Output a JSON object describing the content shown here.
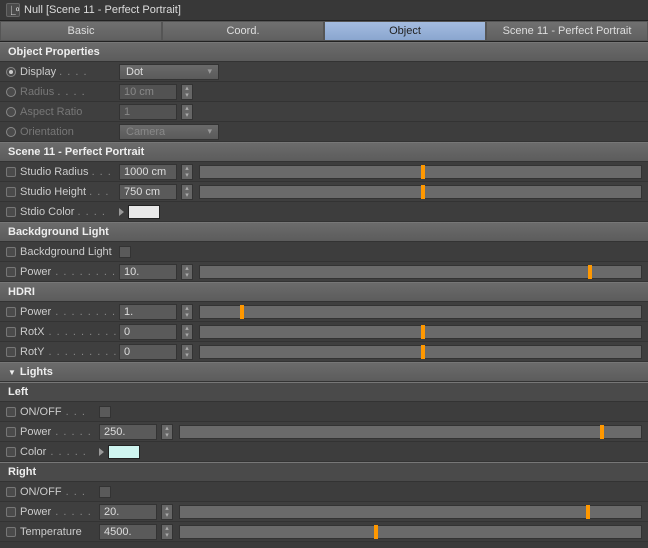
{
  "title": "Null [Scene 11 - Perfect Portrait]",
  "tabs": [
    "Basic",
    "Coord.",
    "Object",
    "Scene 11 - Perfect Portrait"
  ],
  "active_tab": 2,
  "sections": {
    "objprops": {
      "header": "Object Properties",
      "display": {
        "label": "Display",
        "value": "Dot"
      },
      "radius": {
        "label": "Radius",
        "value": "10 cm"
      },
      "aspect": {
        "label": "Aspect Ratio",
        "value": "1"
      },
      "orientation": {
        "label": "Orientation",
        "value": "Camera"
      }
    },
    "scene": {
      "header": "Scene 11 - Perfect Portrait",
      "studio_radius": {
        "label": "Studio Radius",
        "value": "1000 cm",
        "pos": 50
      },
      "studio_height": {
        "label": "Studio Height",
        "value": "750 cm",
        "pos": 50
      },
      "stdio_color": {
        "label": "Stdio Color",
        "value": "#e8e8e8"
      }
    },
    "bglight": {
      "header": "Backdground Light",
      "toggle": {
        "label": "Backdground Light"
      },
      "power": {
        "label": "Power",
        "value": "10.",
        "pos": 88
      }
    },
    "hdri": {
      "header": "HDRI",
      "power": {
        "label": "Power",
        "value": "1.",
        "pos": 9
      },
      "rotx": {
        "label": "RotX",
        "value": "0",
        "pos": 50
      },
      "roty": {
        "label": "RotY",
        "value": "0",
        "pos": 50
      }
    },
    "lights": {
      "header": "Lights",
      "left": {
        "header": "Left",
        "onoff": {
          "label": "ON/OFF"
        },
        "power": {
          "label": "Power",
          "value": "250.",
          "pos": 91
        },
        "color": {
          "label": "Color",
          "value": "#cff5f0"
        }
      },
      "right": {
        "header": "Right",
        "onoff": {
          "label": "ON/OFF"
        },
        "power": {
          "label": "Power",
          "value": "20.",
          "pos": 88
        },
        "temperature": {
          "label": "Temperature",
          "value": "4500.",
          "pos": 42
        }
      }
    }
  }
}
